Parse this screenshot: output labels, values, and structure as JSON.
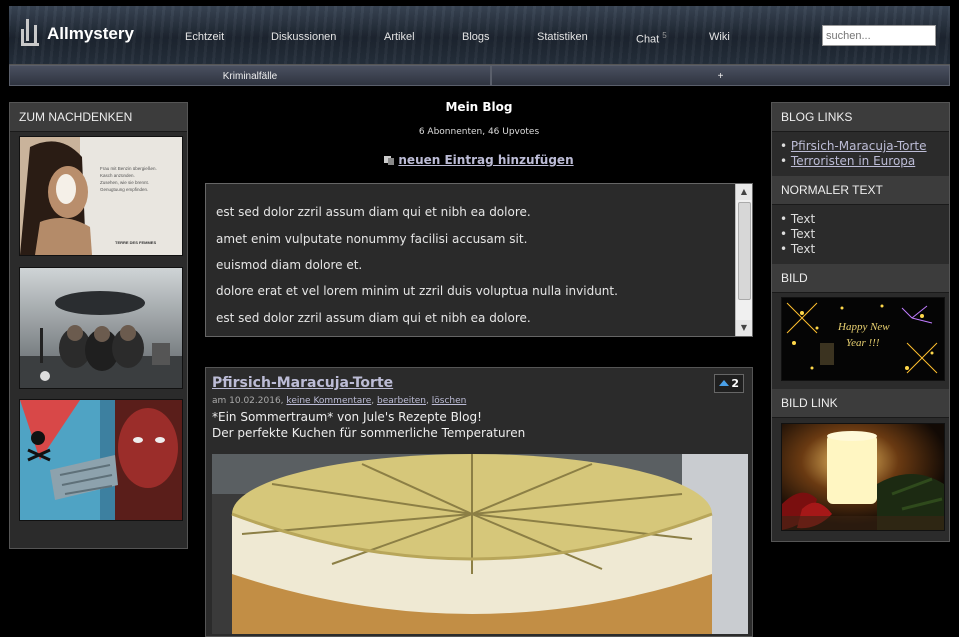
{
  "header": {
    "logo_text": "Allmystery",
    "nav": [
      {
        "label": "Echtzeit"
      },
      {
        "label": "Diskussionen"
      },
      {
        "label": "Artikel"
      },
      {
        "label": "Blogs"
      },
      {
        "label": "Statistiken"
      },
      {
        "label": "Chat",
        "badge": "5"
      },
      {
        "label": "Wiki"
      }
    ],
    "search_placeholder": "suchen..."
  },
  "subnav": {
    "tab1": "Kriminalfälle",
    "tab2": "+"
  },
  "left": {
    "title": "ZUM NACHDENKEN",
    "poster_text": "Frau mit Benzin übergießen. Kasch anzünden. Zusehen, wie sie brennt. Genugtuung empfinden.",
    "poster_brand": "TERRE DES FEMMES"
  },
  "center": {
    "blog_title": "Mein Blog",
    "blog_stats": "6 Abonnenten, 46 Upvotes",
    "new_entry": "neuen Eintrag hinzufügen",
    "text_lines": [
      "est sed dolor zzril assum diam qui et nibh ea dolore.",
      "amet enim vulputate nonummy facilisi accusam sit.",
      "euismod diam dolore et.",
      "dolore erat et vel lorem minim ut zzril duis voluptua nulla invidunt.",
      "est sed dolor zzril assum diam qui et nibh ea dolore."
    ],
    "post": {
      "title": "Pfirsich-Maracuja-Torte",
      "upvotes": "2",
      "meta_date": "am 10.02.2016,",
      "meta_comments": "keine Kommentare",
      "meta_edit": "bearbeiten",
      "meta_delete": "löschen",
      "text1": "*Ein Sommertraum* von Jule's Rezepte Blog!",
      "text2": "Der perfekte Kuchen für sommerliche Temperaturen"
    }
  },
  "right": {
    "blog_links_title": "BLOG LINKS",
    "blog_links": [
      "Pfirsich-Maracuja-Torte",
      "Terroristen in Europa"
    ],
    "normal_text_title": "NORMALER TEXT",
    "normal_text": [
      "Text",
      "Text",
      "Text"
    ],
    "image_title": "BILD",
    "image_text": "Happy New Year !!!",
    "image_link_title": "BILD LINK"
  },
  "colors": {
    "link": "#bcbcd6",
    "panel": "#2b2b2b",
    "upvote_arrow": "#4aa0e8"
  }
}
